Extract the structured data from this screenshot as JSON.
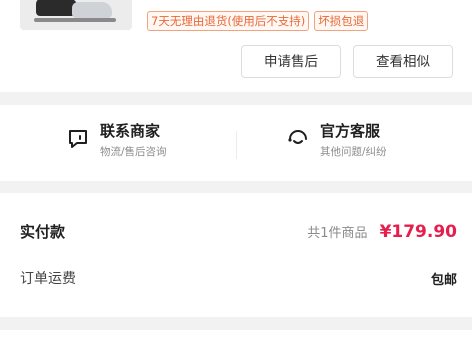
{
  "product": {
    "tags": [
      "7天无理由退货(使用后不支持)",
      "坏损包退"
    ],
    "actions": {
      "after_sale": "申请售后",
      "view_similar": "查看相似"
    }
  },
  "contact": {
    "merchant": {
      "title": "联系商家",
      "subtitle": "物流/售后咨询"
    },
    "service": {
      "title": "官方客服",
      "subtitle": "其他问题/纠纷"
    }
  },
  "payment": {
    "paid_label": "实付款",
    "item_count": "共1件商品",
    "price": "¥179.90",
    "shipping_label": "订单运费",
    "shipping_value": "包邮"
  },
  "colors": {
    "price": "#e61e4d",
    "tag": "#e8683a",
    "background": "#f2f2f2"
  }
}
